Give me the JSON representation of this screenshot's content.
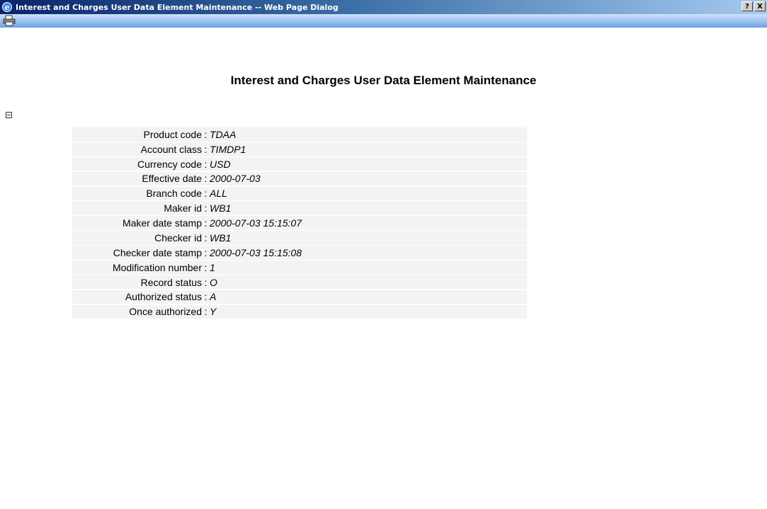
{
  "window": {
    "title": "Interest and Charges User Data Element Maintenance -- Web Page Dialog",
    "help_label": "?",
    "close_label": "X",
    "app_icon": "ie-icon"
  },
  "toolbar": {
    "print_icon": "printer-icon"
  },
  "page": {
    "heading": "Interest and Charges User Data Element Maintenance",
    "collapse_icon": "collapse-minus-icon"
  },
  "separator": ":",
  "fields": [
    {
      "label": "Product code",
      "value": "TDAA"
    },
    {
      "label": "Account class",
      "value": "TIMDP1"
    },
    {
      "label": "Currency code",
      "value": "USD"
    },
    {
      "label": "Effective date",
      "value": "2000-07-03"
    },
    {
      "label": "Branch code",
      "value": "ALL"
    },
    {
      "label": "Maker id",
      "value": "WB1"
    },
    {
      "label": "Maker date stamp",
      "value": "2000-07-03 15:15:07"
    },
    {
      "label": "Checker id",
      "value": "WB1"
    },
    {
      "label": "Checker date stamp",
      "value": "2000-07-03 15:15:08"
    },
    {
      "label": "Modification number",
      "value": "1"
    },
    {
      "label": "Record status",
      "value": "O"
    },
    {
      "label": "Authorized status",
      "value": "A"
    },
    {
      "label": "Once authorized",
      "value": "Y"
    }
  ]
}
